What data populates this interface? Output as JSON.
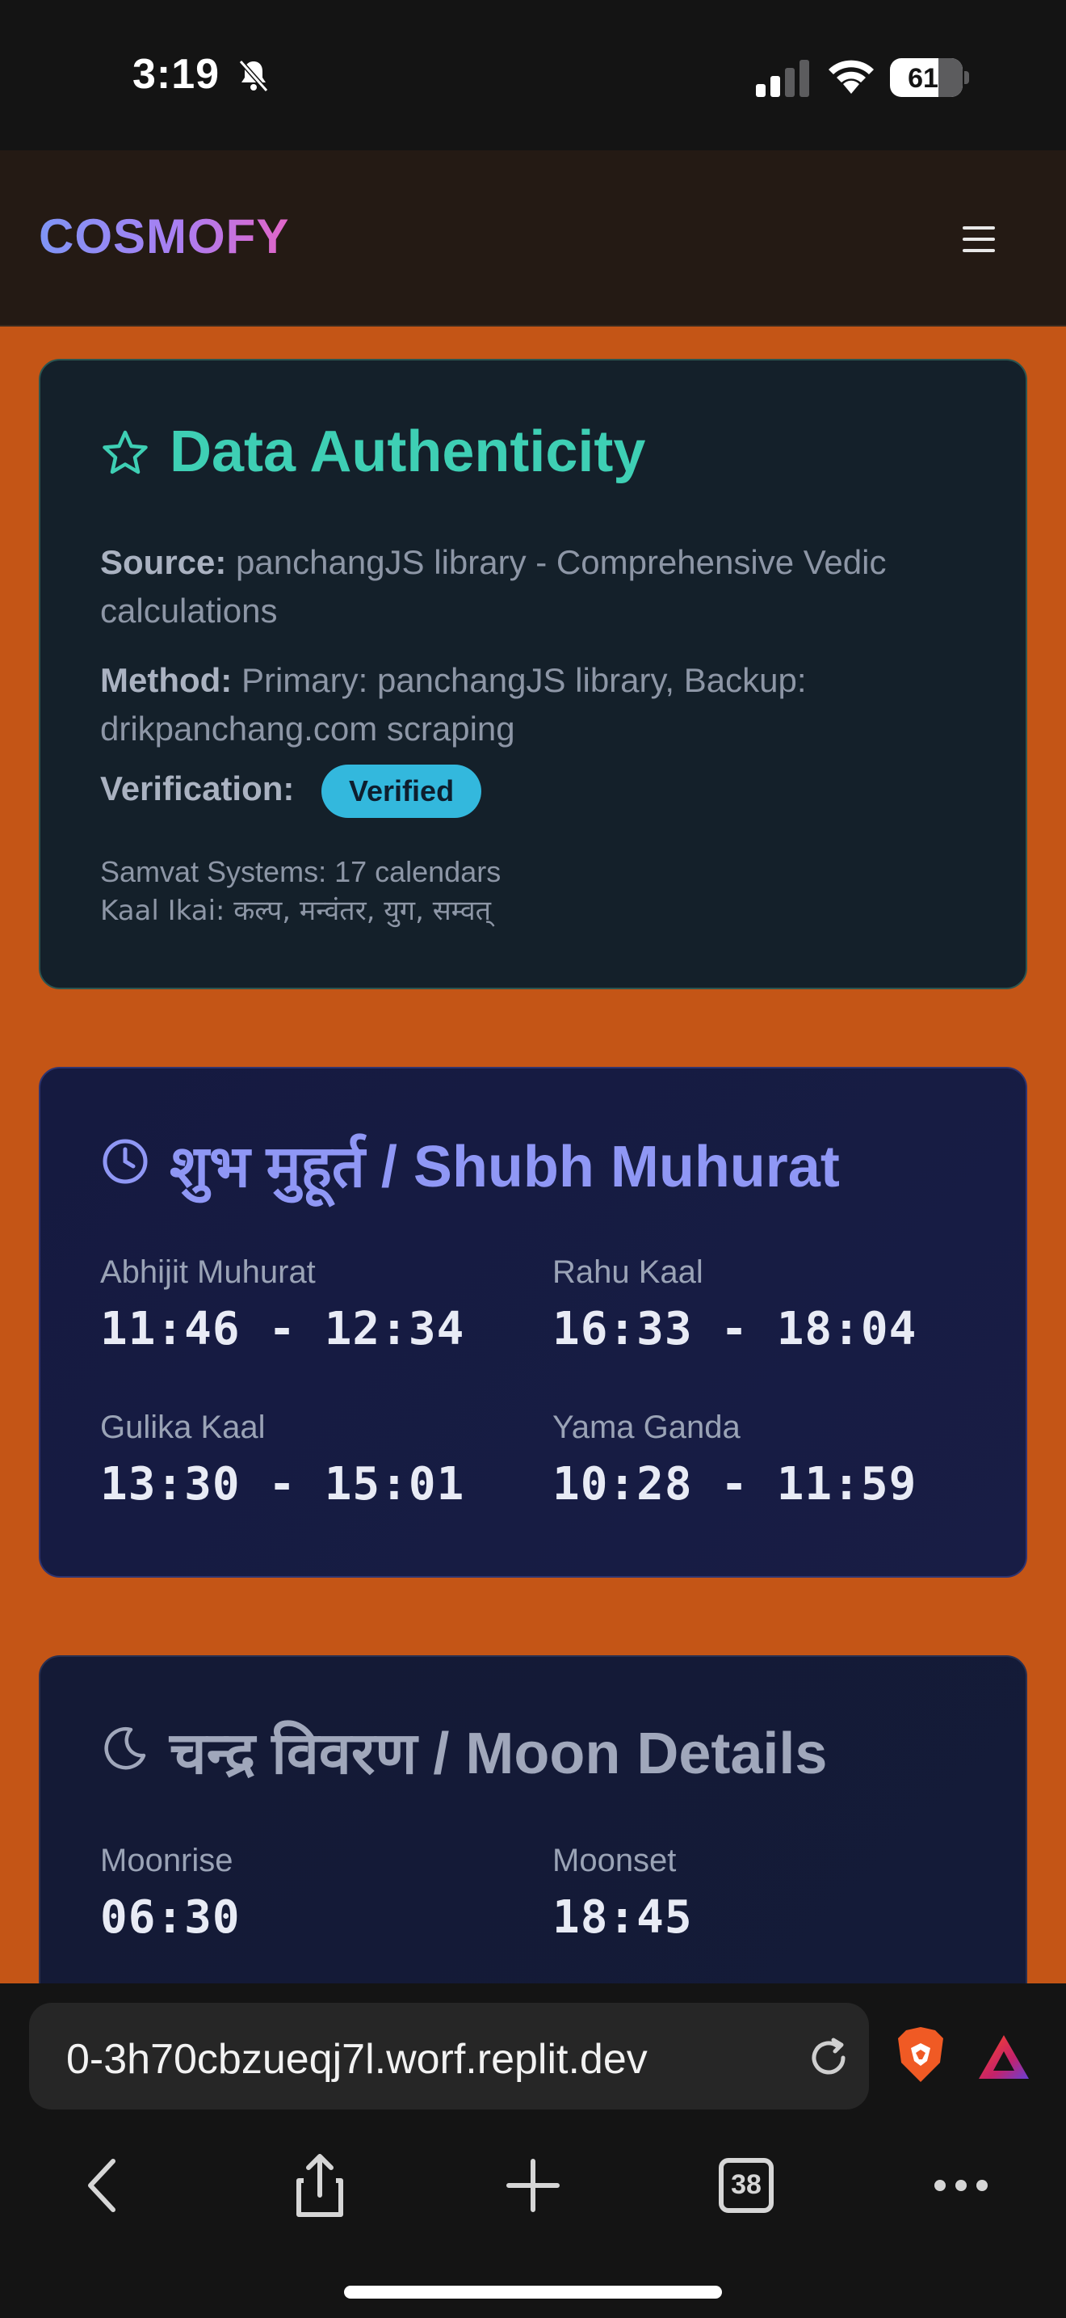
{
  "status_bar": {
    "time": "3:19",
    "battery": "61"
  },
  "header": {
    "brand": "COSMOFY"
  },
  "authenticity": {
    "title": "Data Authenticity",
    "source_label": "Source:",
    "source_value": " panchangJS library - Comprehensive Vedic calculations",
    "method_label": "Method:",
    "method_value": " Primary: panchangJS library, Backup: drikpanchang.com scraping",
    "verification_label": "Verification:",
    "verification_badge": "Verified",
    "samvat": "Samvat Systems: 17 calendars",
    "kaal_ikai": "Kaal Ikai: कल्प, मन्वंतर, युग, सम्वत्"
  },
  "muhurat": {
    "title": "शुभ मुहूर्त / Shubh Muhurat",
    "items": [
      {
        "label": "Abhijit Muhurat",
        "value": "11:46 - 12:34"
      },
      {
        "label": "Rahu Kaal",
        "value": "16:33 - 18:04"
      },
      {
        "label": "Gulika Kaal",
        "value": "13:30 - 15:01"
      },
      {
        "label": "Yama Ganda",
        "value": "10:28 - 11:59"
      }
    ]
  },
  "moon": {
    "title": "चन्द्र विवरण / Moon Details",
    "items": [
      {
        "label": "Moonrise",
        "value": "06:30"
      },
      {
        "label": "Moonset",
        "value": "18:45"
      }
    ]
  },
  "browser": {
    "url": "0-3h70cbzueqj7l.worf.replit.dev",
    "tabs_count": "38"
  },
  "colors": {
    "page_bg": "#c45516",
    "accent_teal": "#3ecfb4",
    "accent_indigo": "#8f97f5",
    "badge": "#33b8dd"
  }
}
